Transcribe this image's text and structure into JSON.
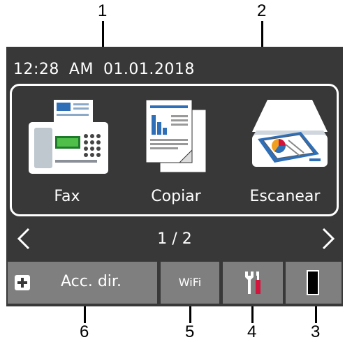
{
  "callouts": {
    "c1": "1",
    "c2": "2",
    "c3": "3",
    "c4": "4",
    "c5": "5",
    "c6": "6"
  },
  "status": {
    "time": "12:28",
    "ampm": "AM",
    "date": "01.01.2018"
  },
  "apps": [
    {
      "label": "Fax",
      "icon": "fax-machine-icon"
    },
    {
      "label": "Copiar",
      "icon": "copy-documents-icon"
    },
    {
      "label": "Escanear",
      "icon": "scanner-icon"
    }
  ],
  "pager": {
    "indicator": "1 / 2"
  },
  "bottom": {
    "shortcut_label": "Acc. dir.",
    "wifi_label": "WiFi",
    "settings_icon": "tools-icon",
    "toner_icon": "toner-icon"
  },
  "colors": {
    "screen": "#383838",
    "bar": "#7f7f7f",
    "accent_red": "#d3143c",
    "accent_blue": "#2f6fb8"
  }
}
